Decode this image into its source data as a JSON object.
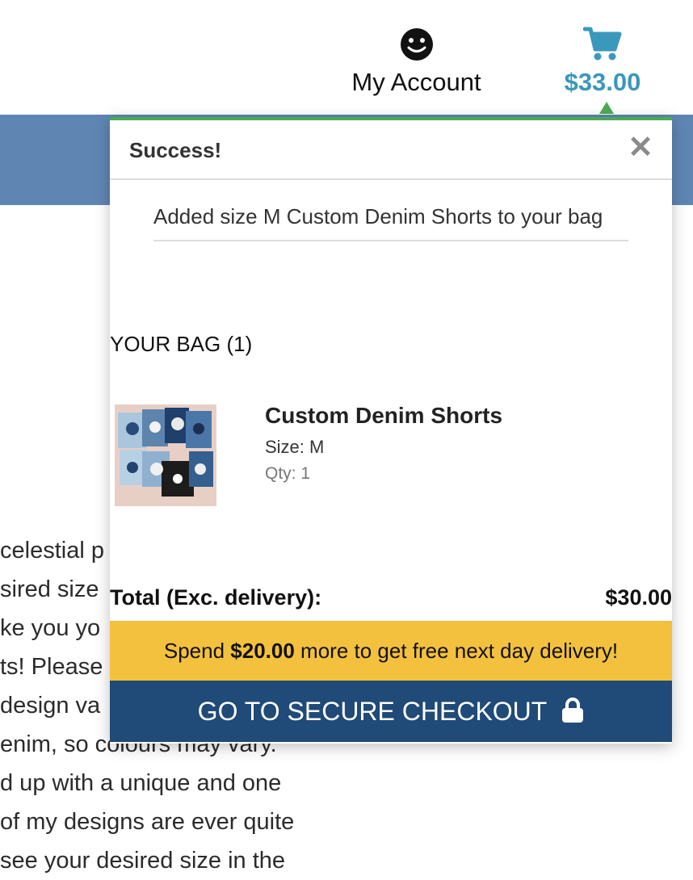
{
  "header": {
    "account_label": "My Account",
    "account_icon": "smiley-face-icon",
    "cart_total": "$33.00",
    "cart_icon": "shopping-cart-icon",
    "accent_color": "#3a98bc"
  },
  "article": {
    "lines": [
      "celestial p",
      "sired size",
      "ke you yo",
      "ts! Please",
      "design va",
      "enim, so colours may vary.",
      "d up with a unique and one",
      "of my designs are ever quite",
      "see your desired size in the"
    ]
  },
  "minicart": {
    "title": "Success!",
    "close_symbol": "✕",
    "message": "Added size M Custom Denim Shorts to your bag",
    "bag_label": "YOUR BAG (1)",
    "item": {
      "name": "Custom Denim Shorts",
      "size": "Size: M",
      "qty": "Qty: 1"
    },
    "total_label": "Total (Exc. delivery):",
    "total_value": "$30.00",
    "promo_before": "Spend ",
    "promo_amount": "$20.00",
    "promo_after": " more to get free next day delivery!",
    "checkout_label": "GO TO SECURE CHECKOUT",
    "checkout_icon": "lock-icon",
    "success_color": "#4caa55",
    "promo_color": "#f4c13e",
    "checkout_color": "#204a77"
  }
}
